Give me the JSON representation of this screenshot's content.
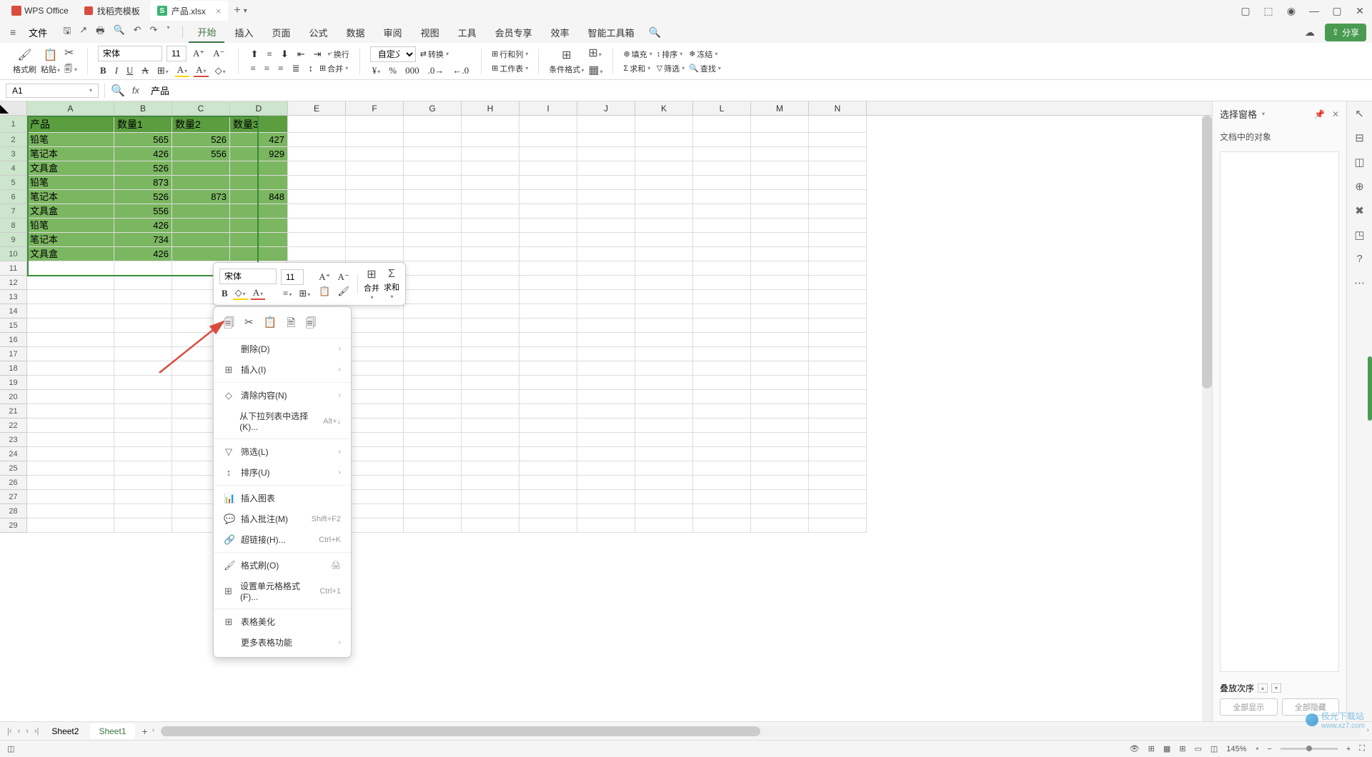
{
  "app": {
    "name": "WPS Office"
  },
  "tabs": [
    {
      "label": "找稻壳模板",
      "active": false
    },
    {
      "label": "产品.xlsx",
      "active": true
    }
  ],
  "menu": {
    "file": "文件",
    "items": [
      "开始",
      "插入",
      "页面",
      "公式",
      "数据",
      "审阅",
      "视图",
      "工具",
      "会员专享",
      "效率",
      "智能工具箱"
    ]
  },
  "ribbon": {
    "format_brush": "格式刷",
    "paste": "粘贴",
    "font_name": "宋体",
    "font_size": "11",
    "wrap": "换行",
    "merge": "合并",
    "custom": "自定义",
    "convert": "转换",
    "row_col": "行和列",
    "worksheet": "工作表",
    "cond_fmt": "条件格式",
    "fill": "填充",
    "sort": "排序",
    "freeze": "冻结",
    "sum": "求和",
    "filter": "筛选",
    "find": "查找"
  },
  "share": "分享",
  "name_box": "A1",
  "fx_value": "产品",
  "columns": [
    "A",
    "B",
    "C",
    "D",
    "E",
    "F",
    "G",
    "H",
    "I",
    "J",
    "K",
    "L",
    "M",
    "N"
  ],
  "headers": [
    "产品",
    "数量1",
    "数量2",
    "数量3"
  ],
  "rows": [
    {
      "a": "铅笔",
      "b": "565",
      "c": "526",
      "d": "427"
    },
    {
      "a": "笔记本",
      "b": "426",
      "c": "556",
      "d": "929"
    },
    {
      "a": "文具盒",
      "b": "526",
      "c": "",
      "d": ""
    },
    {
      "a": "铅笔",
      "b": "873",
      "c": "",
      "d": ""
    },
    {
      "a": "笔记本",
      "b": "526",
      "c": "873",
      "d": "848"
    },
    {
      "a": "文具盒",
      "b": "556",
      "c": "",
      "d": ""
    },
    {
      "a": "铅笔",
      "b": "426",
      "c": "",
      "d": ""
    },
    {
      "a": "笔记本",
      "b": "734",
      "c": "",
      "d": ""
    },
    {
      "a": "文具盒",
      "b": "426",
      "c": "",
      "d": ""
    }
  ],
  "mini": {
    "font_name": "宋体",
    "font_size": "11",
    "merge": "合并",
    "sum": "求和"
  },
  "context": {
    "delete": "删除(D)",
    "insert": "插入(I)",
    "clear": "清除内容(N)",
    "dropdown": "从下拉列表中选择(K)...",
    "dropdown_sc": "Alt+↓",
    "filter": "筛选(L)",
    "sort": "排序(U)",
    "chart": "插入图表",
    "comment": "插入批注(M)",
    "comment_sc": "Shift+F2",
    "link": "超链接(H)...",
    "link_sc": "Ctrl+K",
    "fmtbrush": "格式刷(O)",
    "cellfmt": "设置单元格格式(F)...",
    "cellfmt_sc": "Ctrl+1",
    "beautify": "表格美化",
    "more": "更多表格功能"
  },
  "side": {
    "title": "选择窗格",
    "sub": "文档中的对象",
    "order": "叠放次序",
    "show_all": "全部显示",
    "hide_all": "全部隐藏"
  },
  "sheets": {
    "s2": "Sheet2",
    "s1": "Sheet1"
  },
  "status": {
    "zoom": "145%"
  },
  "watermark": {
    "brand": "极光下载站",
    "url": "www.xz7.com"
  }
}
